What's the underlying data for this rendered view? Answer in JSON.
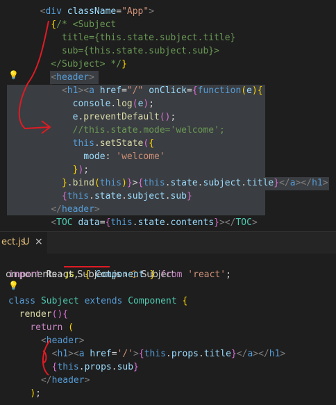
{
  "top_code": {
    "lines": [
      [
        {
          "c": "t",
          "v": "  "
        },
        {
          "c": "t",
          "v": "<"
        },
        {
          "c": "tag",
          "v": "div"
        },
        {
          "c": "attr",
          "v": " className"
        },
        {
          "c": "plain",
          "v": "="
        },
        {
          "c": "str",
          "v": "\"App\""
        },
        {
          "c": "t",
          "v": ">"
        }
      ],
      [
        {
          "c": "plain",
          "v": "    "
        },
        {
          "c": "brace2",
          "v": "{"
        },
        {
          "c": "cmt",
          "v": "/* <Subject"
        }
      ],
      [
        {
          "c": "cmt",
          "v": "      title={this.state.subject.title}"
        }
      ],
      [
        {
          "c": "cmt",
          "v": "      sub={this.state.subject.sub}>"
        }
      ],
      [
        {
          "c": "cmt",
          "v": "    </Subject> */"
        },
        {
          "c": "brace2",
          "v": "}"
        }
      ],
      [
        {
          "c": "plain",
          "v": "    "
        },
        {
          "c": "t",
          "v": "<"
        },
        {
          "c": "tag",
          "v": "header"
        },
        {
          "c": "t",
          "v": ">"
        }
      ],
      [
        {
          "c": "plain",
          "v": "      "
        },
        {
          "c": "t",
          "v": "<"
        },
        {
          "c": "tag",
          "v": "h1"
        },
        {
          "c": "t",
          "v": ">"
        },
        {
          "c": "t",
          "v": "<"
        },
        {
          "c": "tag",
          "v": "a"
        },
        {
          "c": "attr",
          "v": " href"
        },
        {
          "c": "plain",
          "v": "="
        },
        {
          "c": "str",
          "v": "\"/\""
        },
        {
          "c": "attr",
          "v": " onClick"
        },
        {
          "c": "plain",
          "v": "="
        },
        {
          "c": "brace",
          "v": "{"
        },
        {
          "c": "this",
          "v": "function"
        },
        {
          "c": "brace2",
          "v": "("
        },
        {
          "c": "var",
          "v": "e"
        },
        {
          "c": "brace2",
          "v": ")"
        },
        {
          "c": "brace2",
          "v": "{"
        }
      ],
      [
        {
          "c": "plain",
          "v": "        "
        },
        {
          "c": "var",
          "v": "console"
        },
        {
          "c": "plain",
          "v": "."
        },
        {
          "c": "fn",
          "v": "log"
        },
        {
          "c": "brace",
          "v": "("
        },
        {
          "c": "var",
          "v": "e"
        },
        {
          "c": "brace",
          "v": ")"
        },
        {
          "c": "plain",
          "v": ";"
        }
      ],
      [
        {
          "c": "plain",
          "v": "        "
        },
        {
          "c": "var",
          "v": "e"
        },
        {
          "c": "plain",
          "v": "."
        },
        {
          "c": "fn",
          "v": "preventDefault"
        },
        {
          "c": "brace",
          "v": "()"
        },
        {
          "c": "plain",
          "v": ";"
        }
      ],
      [
        {
          "c": "plain",
          "v": "        "
        },
        {
          "c": "cmt",
          "v": "//this.state.mode='welcome';"
        }
      ],
      [
        {
          "c": "plain",
          "v": "        "
        },
        {
          "c": "this",
          "v": "this"
        },
        {
          "c": "plain",
          "v": "."
        },
        {
          "c": "fn",
          "v": "setState"
        },
        {
          "c": "brace",
          "v": "("
        },
        {
          "c": "brace2",
          "v": "{"
        }
      ],
      [
        {
          "c": "plain",
          "v": "          "
        },
        {
          "c": "var",
          "v": "mode"
        },
        {
          "c": "plain",
          "v": ": "
        },
        {
          "c": "str",
          "v": "'welcome'"
        }
      ],
      [
        {
          "c": "plain",
          "v": "        "
        },
        {
          "c": "brace2",
          "v": "}"
        },
        {
          "c": "brace",
          "v": ")"
        },
        {
          "c": "plain",
          "v": ";"
        }
      ],
      [
        {
          "c": "plain",
          "v": "      "
        },
        {
          "c": "brace2",
          "v": "}"
        },
        {
          "c": "plain",
          "v": "."
        },
        {
          "c": "fn",
          "v": "bind"
        },
        {
          "c": "brace2",
          "v": "("
        },
        {
          "c": "this",
          "v": "this"
        },
        {
          "c": "brace2",
          "v": ")"
        },
        {
          "c": "brace",
          "v": "}"
        },
        {
          "c": "plain",
          "v": ">"
        },
        {
          "c": "brace",
          "v": "{"
        },
        {
          "c": "this",
          "v": "this"
        },
        {
          "c": "plain",
          "v": "."
        },
        {
          "c": "var",
          "v": "state"
        },
        {
          "c": "plain",
          "v": "."
        },
        {
          "c": "var",
          "v": "subject"
        },
        {
          "c": "plain",
          "v": "."
        },
        {
          "c": "var",
          "v": "title"
        },
        {
          "c": "brace",
          "v": "}"
        },
        {
          "c": "t",
          "v": "</"
        },
        {
          "c": "tag",
          "v": "a"
        },
        {
          "c": "t",
          "v": "></"
        },
        {
          "c": "tag",
          "v": "h1"
        },
        {
          "c": "t",
          "v": ">"
        }
      ],
      [
        {
          "c": "plain",
          "v": "      "
        },
        {
          "c": "brace",
          "v": "{"
        },
        {
          "c": "this",
          "v": "this"
        },
        {
          "c": "plain",
          "v": "."
        },
        {
          "c": "var",
          "v": "state"
        },
        {
          "c": "plain",
          "v": "."
        },
        {
          "c": "var",
          "v": "subject"
        },
        {
          "c": "plain",
          "v": "."
        },
        {
          "c": "var",
          "v": "sub"
        },
        {
          "c": "brace",
          "v": "}"
        }
      ],
      [
        {
          "c": "plain",
          "v": "    "
        },
        {
          "c": "t",
          "v": "</"
        },
        {
          "c": "tag",
          "v": "header"
        },
        {
          "c": "t",
          "v": ">"
        }
      ],
      [
        {
          "c": "plain",
          "v": "    "
        },
        {
          "c": "t",
          "v": "<"
        },
        {
          "c": "ctag",
          "v": "TOC"
        },
        {
          "c": "attr",
          "v": " data"
        },
        {
          "c": "plain",
          "v": "="
        },
        {
          "c": "brace",
          "v": "{"
        },
        {
          "c": "this",
          "v": "this"
        },
        {
          "c": "plain",
          "v": "."
        },
        {
          "c": "var",
          "v": "state"
        },
        {
          "c": "plain",
          "v": "."
        },
        {
          "c": "var",
          "v": "contents"
        },
        {
          "c": "brace",
          "v": "}"
        },
        {
          "c": "t",
          "v": "></"
        },
        {
          "c": "ctag",
          "v": "TOC"
        },
        {
          "c": "t",
          "v": ">"
        }
      ]
    ]
  },
  "tab": {
    "label": "ect.js",
    "status": "U",
    "close": "×"
  },
  "breadcrumb": {
    "folder": "omponents",
    "sep": " › ",
    "file_icon": "JS",
    "file": "Subject.js",
    "symbol": "Subject"
  },
  "bottom_code": {
    "lines": [
      [
        {
          "c": "kw",
          "v": "import"
        },
        {
          "c": "plain",
          "v": " React, "
        },
        {
          "c": "brace2",
          "v": "{"
        },
        {
          "c": "var",
          "v": " Component "
        },
        {
          "c": "brace2",
          "v": "}"
        },
        {
          "c": "kw",
          "v": " from"
        },
        {
          "c": "str",
          "v": " 'react'"
        },
        {
          "c": "plain",
          "v": ";"
        }
      ],
      [
        {
          "c": "plain",
          "v": ""
        }
      ],
      [
        {
          "c": "this",
          "v": "class"
        },
        {
          "c": "cls",
          "v": " Subject"
        },
        {
          "c": "this",
          "v": " extends"
        },
        {
          "c": "cls",
          "v": " Component"
        },
        {
          "c": "brace2",
          "v": " {"
        }
      ],
      [
        {
          "c": "plain",
          "v": "  "
        },
        {
          "c": "fn",
          "v": "render"
        },
        {
          "c": "brace",
          "v": "()"
        },
        {
          "c": "brace",
          "v": "{"
        }
      ],
      [
        {
          "c": "plain",
          "v": "    "
        },
        {
          "c": "kw",
          "v": "return"
        },
        {
          "c": "plain",
          "v": " "
        },
        {
          "c": "brace2",
          "v": "("
        }
      ],
      [
        {
          "c": "plain",
          "v": "      "
        },
        {
          "c": "t",
          "v": "<"
        },
        {
          "c": "tag",
          "v": "header"
        },
        {
          "c": "t",
          "v": ">"
        }
      ],
      [
        {
          "c": "plain",
          "v": "        "
        },
        {
          "c": "t",
          "v": "<"
        },
        {
          "c": "tag",
          "v": "h1"
        },
        {
          "c": "t",
          "v": ">"
        },
        {
          "c": "t",
          "v": "<"
        },
        {
          "c": "tag",
          "v": "a"
        },
        {
          "c": "attr",
          "v": " href"
        },
        {
          "c": "plain",
          "v": "="
        },
        {
          "c": "str",
          "v": "'/'"
        },
        {
          "c": "t",
          "v": ">"
        },
        {
          "c": "brace",
          "v": "{"
        },
        {
          "c": "this",
          "v": "this"
        },
        {
          "c": "plain",
          "v": "."
        },
        {
          "c": "var",
          "v": "props"
        },
        {
          "c": "plain",
          "v": "."
        },
        {
          "c": "var",
          "v": "title"
        },
        {
          "c": "brace",
          "v": "}"
        },
        {
          "c": "t",
          "v": "</"
        },
        {
          "c": "tag",
          "v": "a"
        },
        {
          "c": "t",
          "v": "></"
        },
        {
          "c": "tag",
          "v": "h1"
        },
        {
          "c": "t",
          "v": ">"
        }
      ],
      [
        {
          "c": "plain",
          "v": "        "
        },
        {
          "c": "brace",
          "v": "{"
        },
        {
          "c": "this",
          "v": "this"
        },
        {
          "c": "plain",
          "v": "."
        },
        {
          "c": "var",
          "v": "props"
        },
        {
          "c": "plain",
          "v": "."
        },
        {
          "c": "var",
          "v": "sub"
        },
        {
          "c": "brace",
          "v": "}"
        }
      ],
      [
        {
          "c": "plain",
          "v": "      "
        },
        {
          "c": "t",
          "v": "</"
        },
        {
          "c": "tag",
          "v": "header"
        },
        {
          "c": "t",
          "v": ">"
        }
      ],
      [
        {
          "c": "plain",
          "v": "    "
        },
        {
          "c": "brace2",
          "v": ")"
        },
        {
          "c": "plain",
          "v": ";"
        }
      ]
    ]
  },
  "colors": {
    "bg": "#1e1e1e",
    "selection": "#264f78",
    "annotation_red": "#e01b24"
  },
  "icons": {
    "lightbulb": "lightbulb-icon",
    "symbol": "symbol-class-icon",
    "chevron": "chevron-right-icon"
  }
}
